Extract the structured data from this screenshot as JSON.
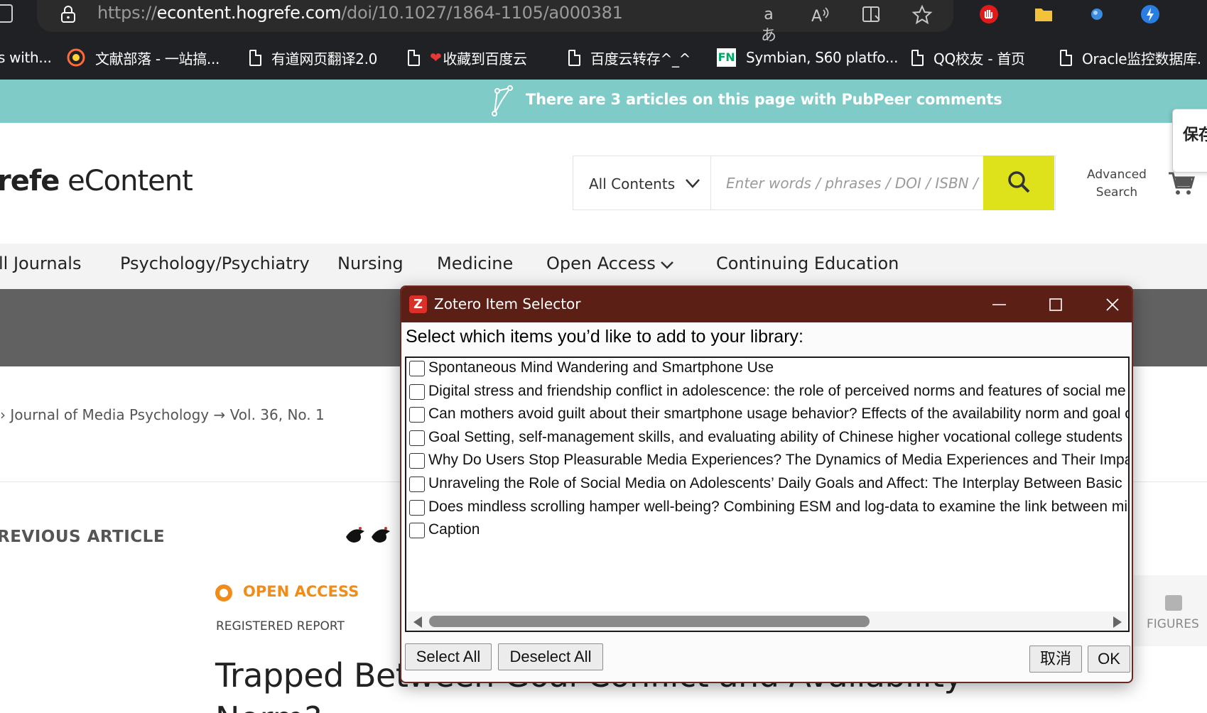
{
  "browser": {
    "url_scheme": "https://",
    "url_host": "econtent.hogrefe.com",
    "url_path": "/doi/10.1027/1864-1105/a000381",
    "read_aloud_glyph": "aあ",
    "toolbar_icons": [
      "translate-icon",
      "read-aloud-icon",
      "split-screen-icon",
      "favorite-star-icon"
    ],
    "bookmarks": [
      {
        "label": "s with...",
        "icon": "none"
      },
      {
        "label": "文献部落 - 一站搞...",
        "icon": "target-icon"
      },
      {
        "label": "有道网页翻译2.0",
        "icon": "doc-icon"
      },
      {
        "label": "收藏到百度云",
        "icon": "heart-icon"
      },
      {
        "label": "百度云转存^_^",
        "icon": "doc-icon"
      },
      {
        "label": "Symbian, S60 platfo...",
        "icon": "fn-icon"
      },
      {
        "label": "QQ校友 - 首页",
        "icon": "doc-icon"
      },
      {
        "label": "Oracle监控数据库.",
        "icon": "doc-icon"
      }
    ],
    "fn_badge": "FN",
    "colors": {
      "chrome": "#202124",
      "pill": "#2b2b2b"
    }
  },
  "pubpeer": {
    "message": "There are 3 articles on this page with PubPeer comments",
    "color": "#7ecbc8"
  },
  "save_tab": {
    "label": "保存"
  },
  "site": {
    "logo_partial": "refe",
    "logo_suffix": "eContent",
    "search": {
      "scope": "All Contents",
      "placeholder": "Enter words / phrases / DOI / ISBN / ",
      "accent": "#dde21a"
    },
    "advanced_search_line1": "Advanced",
    "advanced_search_line2": "Search",
    "nav": [
      "ll Journals",
      "Psychology/Psychiatry",
      "Nursing",
      "Medicine",
      "Open Access",
      "Continuing Education"
    ],
    "breadcrumb": {
      "journal": "Journal of Media Psychology",
      "issue": "Vol. 36, No. 1"
    },
    "prev_article": "REVIOUS ARTICLE",
    "open_access": "OPEN ACCESS",
    "article_type": "REGISTERED REPORT",
    "article_title": "Trapped Between Goal Conflict and Availability",
    "article_title_line2": "Norm?",
    "figures_label": "FIGURES",
    "open_access_color": "#f08c1a"
  },
  "zotero": {
    "title": "Zotero Item Selector",
    "logo_letter": "Z",
    "prompt": "Select which items you’d like to add to your library:",
    "items": [
      {
        "label": "Spontaneous Mind Wandering and Smartphone Use",
        "checked": false
      },
      {
        "label": "Digital stress and friendship conflict in adolescence: the role of perceived norms and features of social me",
        "checked": false
      },
      {
        "label": "Can mothers avoid guilt about their smartphone usage behavior? Effects of the availability norm and goal c",
        "checked": false
      },
      {
        "label": "Goal Setting, self-management skills, and evaluating ability of Chinese higher vocational college students",
        "checked": false
      },
      {
        "label": "Why Do Users Stop Pleasurable Media Experiences? The Dynamics of Media Experiences and Their Impa",
        "checked": false
      },
      {
        "label": "Unraveling the Role of Social Media on Adolescents’ Daily Goals and Affect: The Interplay Between Basic",
        "checked": false
      },
      {
        "label": "Does mindless scrolling hamper well-being? Combining ESM and log-data to examine the link between mi",
        "checked": false
      },
      {
        "label": "Caption",
        "checked": false
      }
    ],
    "select_all": "Select All",
    "deselect_all": "Deselect All",
    "cancel": "取消",
    "ok": "OK",
    "titlebar_color": "#5c1f16"
  }
}
